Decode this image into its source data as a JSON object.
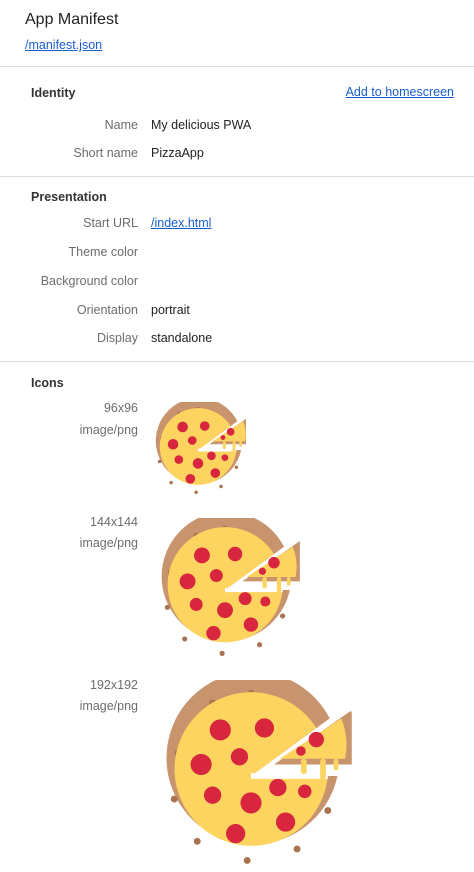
{
  "header": {
    "title": "App Manifest",
    "manifest_link": "/manifest.json"
  },
  "identity": {
    "title": "Identity",
    "add_to_homescreen": "Add to homescreen",
    "rows": [
      {
        "label": "Name",
        "value": "My delicious PWA"
      },
      {
        "label": "Short name",
        "value": "PizzaApp"
      }
    ]
  },
  "presentation": {
    "title": "Presentation",
    "start_url_label": "Start URL",
    "start_url_value": "/index.html",
    "theme_color_label": "Theme color",
    "background_color_label": "Background color",
    "orientation_label": "Orientation",
    "orientation_value": "portrait",
    "display_label": "Display",
    "display_value": "standalone"
  },
  "icons": {
    "title": "Icons",
    "items": [
      {
        "size": "96x96",
        "type": "image/png"
      },
      {
        "size": "144x144",
        "type": "image/png"
      },
      {
        "size": "192x192",
        "type": "image/png"
      }
    ]
  },
  "colors": {
    "link": "#1a5dcc",
    "crust": "#c8946e",
    "cheese": "#fcd45f",
    "pepperoni": "#d7263d"
  }
}
